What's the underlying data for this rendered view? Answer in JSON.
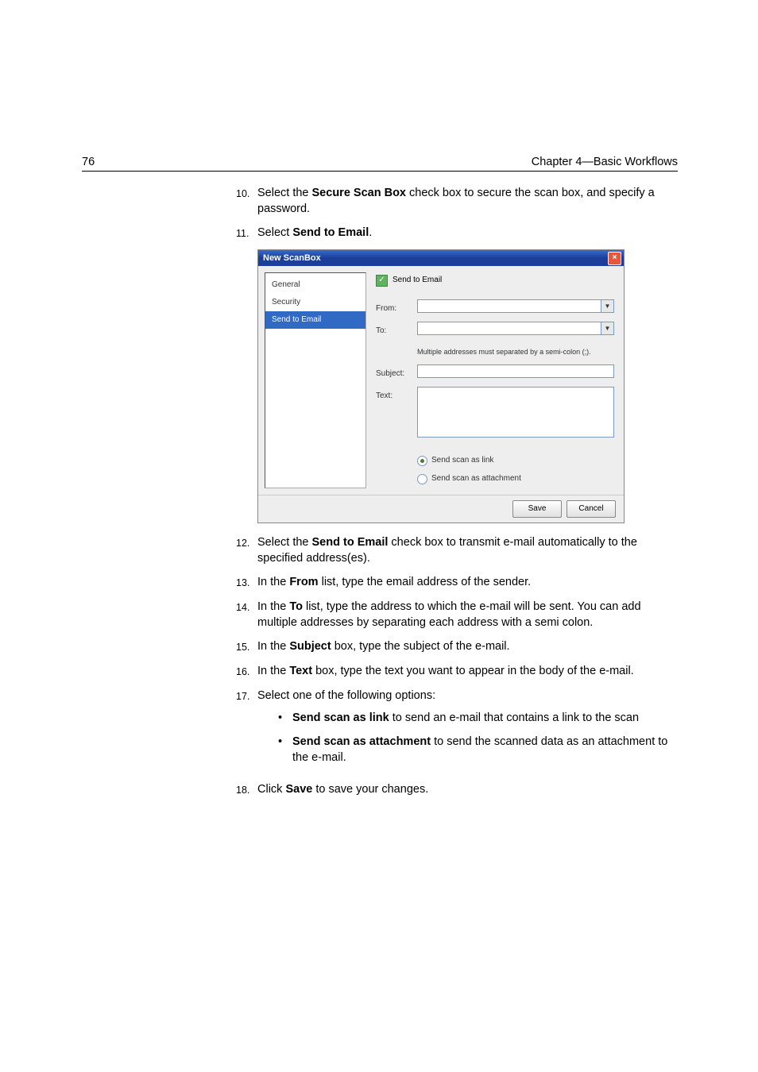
{
  "header": {
    "page_number": "76",
    "chapter": "Chapter 4—Basic Workflows"
  },
  "steps": {
    "s10": {
      "num": "10.",
      "pre": "Select the ",
      "bold": "Secure Scan Box",
      "post": " check box to secure the scan box, and specify a password."
    },
    "s11": {
      "num": "11.",
      "pre": "Select ",
      "bold": "Send to Email",
      "post": "."
    },
    "s12": {
      "num": "12.",
      "pre": "Select the ",
      "bold": "Send to Email",
      "post": " check box to transmit e-mail automatically to the specified address(es)."
    },
    "s13": {
      "num": "13.",
      "pre": "In the ",
      "bold": "From",
      "post": " list, type the email address of the sender."
    },
    "s14": {
      "num": "14.",
      "pre": "In the ",
      "bold": "To",
      "post": " list, type the address to which the e-mail will be sent. You can add multiple addresses by separating each address with a semi colon."
    },
    "s15": {
      "num": "15.",
      "pre": "In the ",
      "bold": "Subject",
      "post": " box, type the subject of the e-mail."
    },
    "s16": {
      "num": "16.",
      "pre": "In the ",
      "bold": "Text",
      "post": " box, type the text you want to appear in the body of the e-mail."
    },
    "s17": {
      "num": "17.",
      "text": "Select one of the following options:",
      "b1": {
        "bold": "Send scan as link",
        "post": " to send an e-mail that contains a link to the scan"
      },
      "b2": {
        "bold": "Send scan as attachment",
        "post": " to send the scanned data as an attachment to the e-mail."
      }
    },
    "s18": {
      "num": "18.",
      "pre": "Click ",
      "bold": "Save",
      "post": " to save your changes."
    }
  },
  "dialog": {
    "title": "New ScanBox",
    "nav": {
      "general": "General",
      "security": "Security",
      "send": "Send to Email"
    },
    "checkbox_label": "Send to Email",
    "from": "From:",
    "to": "To:",
    "to_hint": "Multiple addresses must separated by a semi-colon (;).",
    "subject": "Subject:",
    "text": "Text:",
    "radio_link": "Send scan as link",
    "radio_attach": "Send scan as attachment",
    "save": "Save",
    "cancel": "Cancel"
  }
}
